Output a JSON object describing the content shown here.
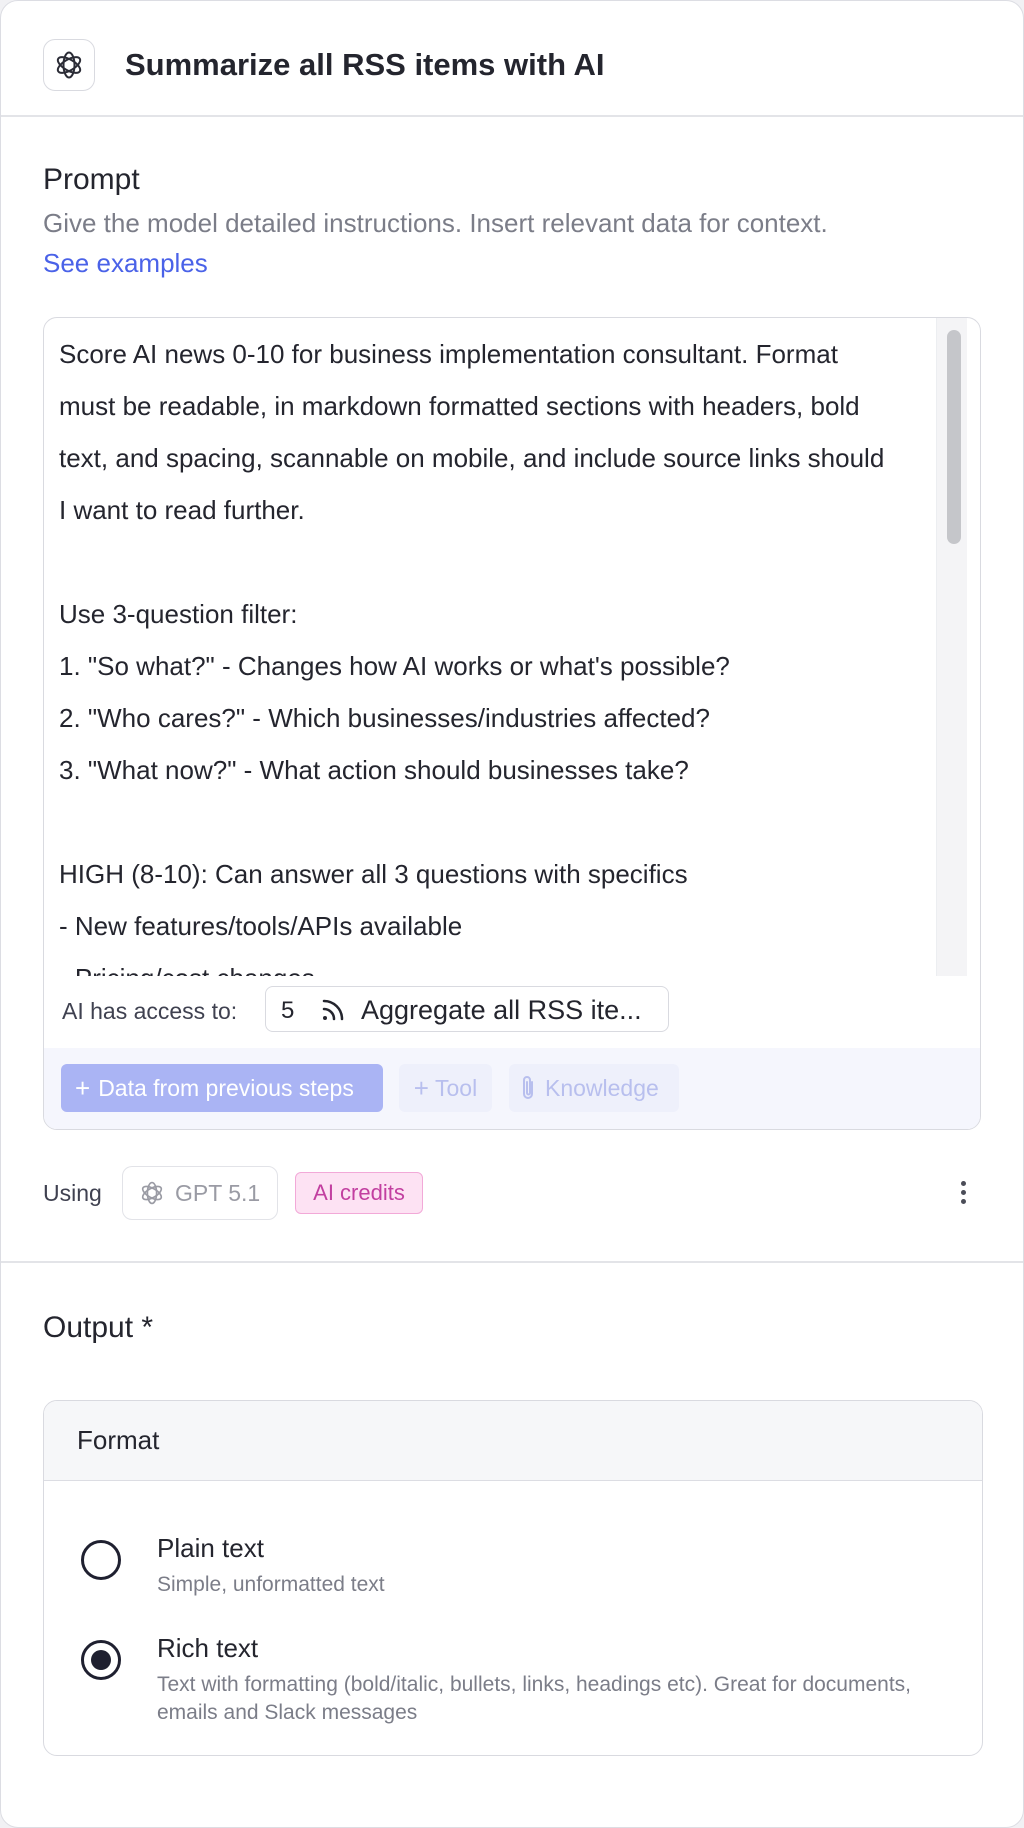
{
  "header": {
    "title": "Summarize all RSS items with AI",
    "logo_icon": "openai-logo-icon"
  },
  "prompt": {
    "label": "Prompt",
    "description": "Give the model detailed instructions. Insert relevant data for context.",
    "link": "See examples",
    "lines": [
      "Score AI news 0-10 for business implementation consultant. Format",
      "must be readable, in markdown formatted sections with headers, bold",
      "text, and spacing, scannable on mobile, and include source links should",
      "I want to read further.",
      "",
      "Use 3-question filter:",
      "1. \"So what?\" - Changes how AI works or what's possible?",
      "2. \"Who cares?\" - Which businesses/industries affected?",
      "3. \"What now?\" - What action should businesses take?",
      "",
      "HIGH (8-10): Can answer all 3 questions with specifics",
      "- New features/tools/APIs available",
      "- Pricing/cost changes"
    ]
  },
  "access": {
    "label": "AI has access to:",
    "step_number": "5",
    "step_icon": "rss-icon",
    "step_label": "Aggregate all RSS ite..."
  },
  "toolbar": {
    "data_button": "Data from previous steps",
    "tool_button": "Tool",
    "knowledge_button": "Knowledge"
  },
  "model": {
    "using_label": "Using",
    "name": "GPT 5.1",
    "credits_badge": "AI credits"
  },
  "output": {
    "title": "Output *",
    "format_label": "Format",
    "options": [
      {
        "title": "Plain text",
        "subtitle": "Simple, unformatted text",
        "selected": false
      },
      {
        "title": "Rich text",
        "subtitle": "Text with formatting (bold/italic, bullets, links, headings etc). Great for documents, emails and Slack messages",
        "selected": true
      }
    ]
  },
  "colors": {
    "accent": "#4a62e8",
    "data_button_bg": "#aab4f4",
    "credits_text": "#c23fa0",
    "credits_bg": "#fde2f3"
  }
}
